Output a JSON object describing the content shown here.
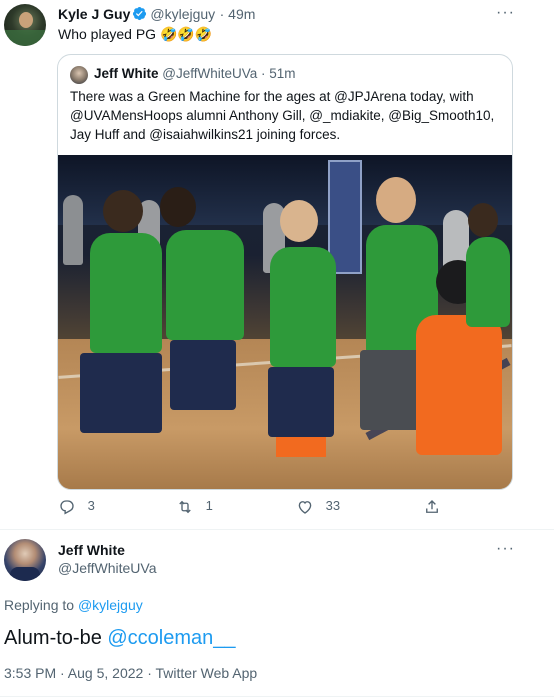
{
  "tweet1": {
    "name": "Kyle J Guy",
    "handle": "@kylejguy",
    "time": "· 49m",
    "text": "Who played PG 🤣🤣🤣",
    "more": "···"
  },
  "quote": {
    "name": "Jeff White",
    "handle": "@JeffWhiteUVa",
    "time": "· 51m",
    "text_line1": "There was a Green Machine for the ages at @JPJArena today, with",
    "text_line2": "@UVAMensHoops alumni Anthony Gill, @_mdiakite, @Big_Smooth10,",
    "text_line3": "Jay Huff and @isaiahwilkins21 joining forces.",
    "photo_description_hidden": ""
  },
  "actions": {
    "reply_count": "3",
    "retweet_count": "1",
    "like_count": "33"
  },
  "tweet2": {
    "name": "Jeff White",
    "handle": "@JeffWhiteUVa",
    "more": "···",
    "replying_prefix": "Replying to ",
    "replying_handle": "@kylejguy",
    "text_plain": "Alum-to-be ",
    "text_mention": "@ccoleman__",
    "meta": "3:53 PM · Aug 5, 2022 · Twitter Web App"
  },
  "colors": {
    "accent": "#1d9bf0",
    "secondary_text": "#536471",
    "border": "#cfd9de"
  }
}
